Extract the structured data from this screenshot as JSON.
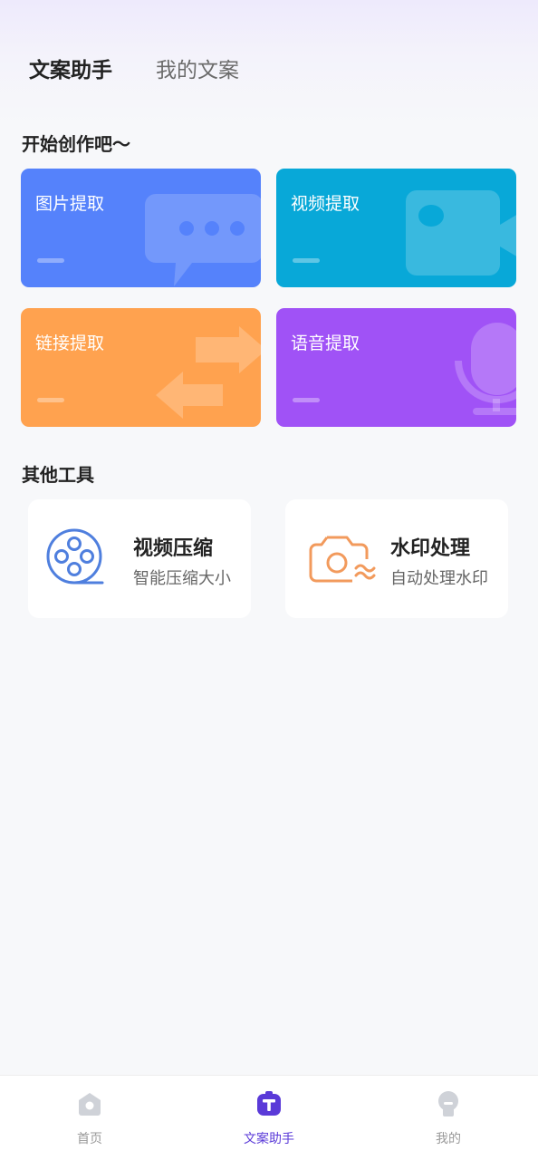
{
  "header": {
    "tabs": [
      {
        "label": "文案助手",
        "active": true
      },
      {
        "label": "我的文案",
        "active": false
      }
    ]
  },
  "create_section": {
    "title": "开始创作吧～",
    "cards": [
      {
        "label": "图片提取",
        "color": "#5582fb",
        "icon": "chat-bubble-icon"
      },
      {
        "label": "视频提取",
        "color": "#08a8d8",
        "icon": "video-camera-icon"
      },
      {
        "label": "链接提取",
        "color": "#ffa24f",
        "icon": "swap-arrows-icon"
      },
      {
        "label": "语音提取",
        "color": "#a052f6",
        "icon": "microphone-icon"
      }
    ]
  },
  "tools_section": {
    "title": "其他工具",
    "tools": [
      {
        "title": "视频压缩",
        "subtitle": "智能压缩大小",
        "icon": "film-reel-icon",
        "color": "#4f7fde"
      },
      {
        "title": "水印处理",
        "subtitle": "自动处理水印",
        "icon": "camera-wave-icon",
        "color": "#f29a5c"
      }
    ]
  },
  "bottom_nav": {
    "items": [
      {
        "label": "首页",
        "icon": "home-icon",
        "active": false
      },
      {
        "label": "文案助手",
        "icon": "text-t-icon",
        "active": true
      },
      {
        "label": "我的",
        "icon": "profile-icon",
        "active": false
      }
    ],
    "accent": "#5a3ad8"
  }
}
